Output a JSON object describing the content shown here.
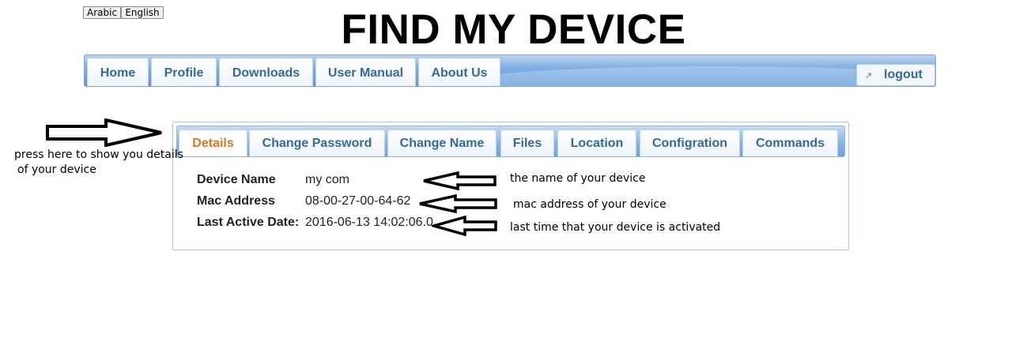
{
  "language": {
    "arabic": "Arabic",
    "english": "English"
  },
  "header": {
    "title": "FIND MY DEVICE"
  },
  "nav": {
    "tabs": [
      "Home",
      "Profile",
      "Downloads",
      "User Manual",
      "About Us"
    ],
    "logout": "logout"
  },
  "details_panel": {
    "tabs": [
      "Details",
      "Change Password",
      "Change Name",
      "Files",
      "Location",
      "Configration",
      "Commands"
    ],
    "active_tab": "Details",
    "fields": [
      {
        "label": "Device Name",
        "value": "my com"
      },
      {
        "label": "Mac Address",
        "value": "08-00-27-00-64-62"
      },
      {
        "label": "Last Active Date:",
        "value": "2016-06-13 14:02:06.0"
      }
    ]
  },
  "annotations": {
    "tab_hint_line1": "press here to show you details",
    "tab_hint_line2": "of your device",
    "device_name_hint": "the name of your device",
    "mac_hint": "mac address of your device",
    "last_active_hint": "last time that your device is activated"
  },
  "colors": {
    "tab_text": "#2e6aa3",
    "active_tab_text": "#e0761c",
    "nav_bar": "#5a98d8"
  }
}
